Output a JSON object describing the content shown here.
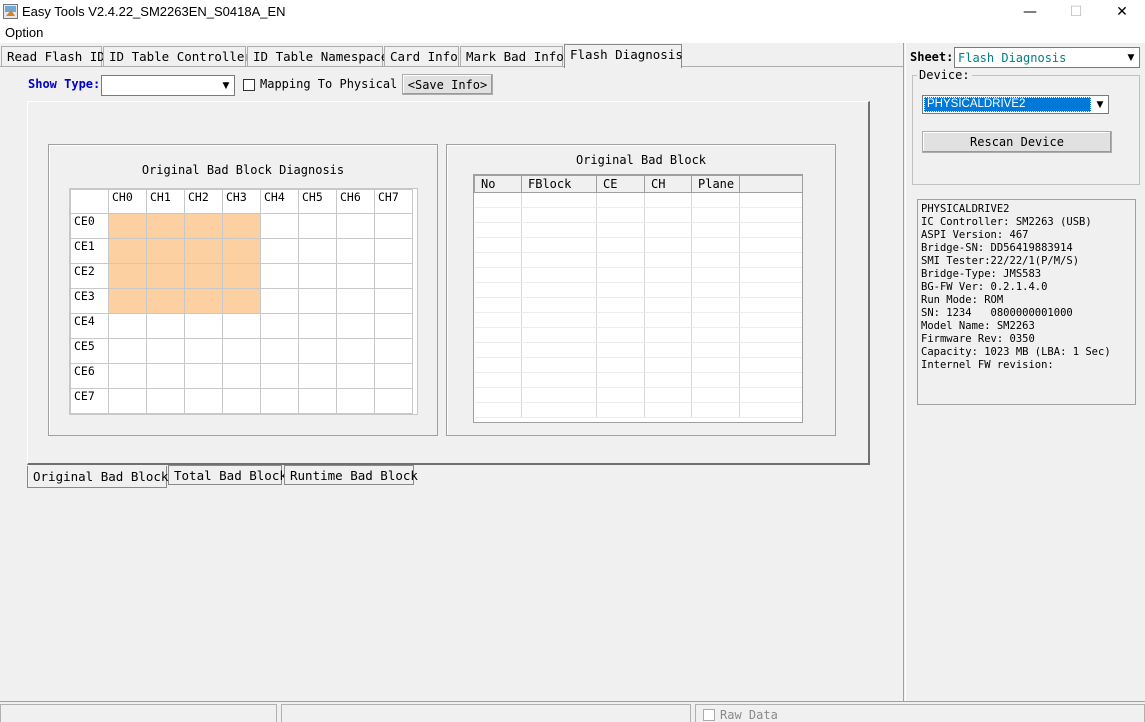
{
  "window": {
    "title": "Easy Tools V2.4.22_SM2263EN_S0418A_EN",
    "controls": {
      "minimize": "—",
      "maximize": "☐",
      "close": "✕"
    }
  },
  "menu": {
    "option": "Option"
  },
  "tabs": [
    {
      "label": "Read Flash ID",
      "active": false
    },
    {
      "label": "ID Table Controller",
      "active": false
    },
    {
      "label": "ID Table Namespace",
      "active": false
    },
    {
      "label": "Card Info",
      "active": false
    },
    {
      "label": "Mark Bad Info",
      "active": false
    },
    {
      "label": "Flash Diagnosis",
      "active": true
    }
  ],
  "toolbar": {
    "show_type_label": "Show Type:",
    "show_type_value": "",
    "mapping_label": "Mapping To Physical",
    "mapping_checked": false,
    "save_info_label": "<Save Info>"
  },
  "diagnosis": {
    "title": "Original Bad Block Diagnosis",
    "columns": [
      "CH0",
      "CH1",
      "CH2",
      "CH3",
      "CH4",
      "CH5",
      "CH6",
      "CH7"
    ],
    "rows": [
      {
        "label": "CE0",
        "cells": [
          1,
          1,
          1,
          1,
          0,
          0,
          0,
          0
        ]
      },
      {
        "label": "CE1",
        "cells": [
          1,
          1,
          1,
          1,
          0,
          0,
          0,
          0
        ]
      },
      {
        "label": "CE2",
        "cells": [
          1,
          1,
          1,
          1,
          0,
          0,
          0,
          0
        ]
      },
      {
        "label": "CE3",
        "cells": [
          1,
          1,
          1,
          1,
          0,
          0,
          0,
          0
        ]
      },
      {
        "label": "CE4",
        "cells": [
          0,
          0,
          0,
          0,
          0,
          0,
          0,
          0
        ]
      },
      {
        "label": "CE5",
        "cells": [
          0,
          0,
          0,
          0,
          0,
          0,
          0,
          0
        ]
      },
      {
        "label": "CE6",
        "cells": [
          0,
          0,
          0,
          0,
          0,
          0,
          0,
          0
        ]
      },
      {
        "label": "CE7",
        "cells": [
          0,
          0,
          0,
          0,
          0,
          0,
          0,
          0
        ]
      }
    ],
    "highlight_color": "#fdd0a2"
  },
  "bad_block_list": {
    "title": "Original Bad Block",
    "headers": [
      "No",
      "FBlock",
      "CE",
      "CH",
      "Plane"
    ],
    "rows": []
  },
  "subtabs": [
    {
      "label": "Original Bad Block",
      "active": true
    },
    {
      "label": "Total Bad Block",
      "active": false
    },
    {
      "label": "Runtime Bad Block",
      "active": false
    }
  ],
  "side": {
    "sheet_label": "Sheet:",
    "sheet_value": "Flash Diagnosis",
    "device_label": "Device:",
    "device_value": "PHYSICALDRIVE2",
    "rescan_label": "Rescan Device",
    "info_lines": [
      "PHYSICALDRIVE2",
      "IC Controller: SM2263 (USB)",
      "ASPI Version: 467",
      "Bridge-SN: DD56419883914",
      "SMI Tester:22/22/1(P/M/S)",
      "Bridge-Type: JMS583",
      "BG-FW Ver: 0.2.1.4.0",
      "Run Mode: ROM",
      "SN: 1234   0800000001000",
      "Model Name: SM2263",
      "Firmware Rev: 0350",
      "Capacity: 1023 MB (LBA: 1 Sec)",
      "Internel FW revision:"
    ]
  },
  "statusbar": {
    "raw_data_label": "Raw Data",
    "raw_data_checked": false
  }
}
